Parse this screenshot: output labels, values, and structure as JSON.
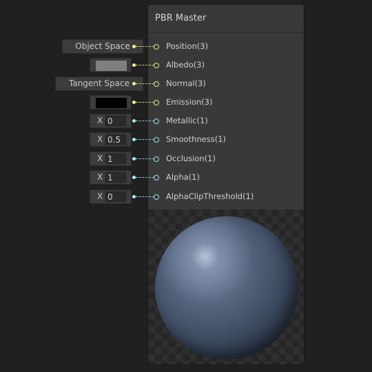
{
  "node": {
    "title": "PBR Master"
  },
  "ports": [
    {
      "label": "Position(3)",
      "type": "space",
      "value": "Object Space",
      "wire": "yellow"
    },
    {
      "label": "Albedo(3)",
      "type": "color",
      "color": "#7f7f7f",
      "wire": "yellow"
    },
    {
      "label": "Normal(3)",
      "type": "space",
      "value": "Tangent Space",
      "wire": "yellow"
    },
    {
      "label": "Emission(3)",
      "type": "color",
      "color": "#000000",
      "wire": "yellow"
    },
    {
      "label": "Metallic(1)",
      "type": "number",
      "axis": "X",
      "value": "0",
      "wire": "cyan"
    },
    {
      "label": "Smoothness(1)",
      "type": "number",
      "axis": "X",
      "value": "0.5",
      "wire": "cyan"
    },
    {
      "label": "Occlusion(1)",
      "type": "number",
      "axis": "X",
      "value": "1",
      "wire": "cyan"
    },
    {
      "label": "Alpha(1)",
      "type": "number",
      "axis": "X",
      "value": "1",
      "wire": "cyan"
    },
    {
      "label": "AlphaClipThreshold(1)",
      "type": "number",
      "axis": "X",
      "value": "0",
      "wire": "cyan"
    }
  ],
  "preview": {
    "icon": "sphere-preview"
  }
}
